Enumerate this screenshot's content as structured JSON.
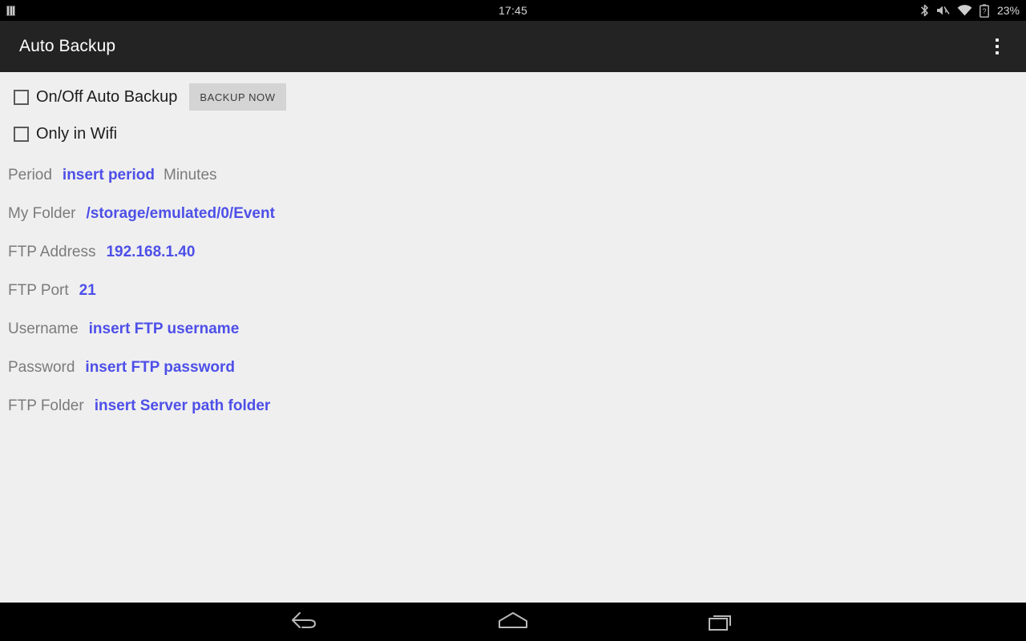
{
  "status_bar": {
    "time": "17:45",
    "battery_percent": "23%",
    "left_icon": "sim-card-icon",
    "icons": [
      "bluetooth-icon",
      "volume-muted-icon",
      "wifi-icon",
      "battery-unknown-icon"
    ]
  },
  "app_bar": {
    "title": "Auto Backup",
    "overflow_label": "overflow-menu"
  },
  "checkboxes": [
    {
      "label": "On/Off Auto Backup",
      "checked": false
    },
    {
      "label": "Only in Wifi",
      "checked": false
    }
  ],
  "buttons": {
    "backup_now": "BACKUP NOW"
  },
  "fields": [
    {
      "label": "Period",
      "value": "insert period",
      "suffix": "Minutes"
    },
    {
      "label": "My Folder",
      "value": "/storage/emulated/0/Event",
      "suffix": ""
    },
    {
      "label": "FTP Address",
      "value": "192.168.1.40",
      "suffix": ""
    },
    {
      "label": "FTP Port",
      "value": "21",
      "suffix": ""
    },
    {
      "label": "Username",
      "value": "insert FTP username",
      "suffix": ""
    },
    {
      "label": "Password",
      "value": "insert FTP password",
      "suffix": ""
    },
    {
      "label": "FTP Folder",
      "value": "insert Server path folder",
      "suffix": ""
    }
  ],
  "nav_bar": {
    "back": "back-button",
    "home": "home-button",
    "recents": "recents-button"
  },
  "colors": {
    "background": "#efefef",
    "app_bar": "#232323",
    "status_bar": "#000000",
    "accent_blue": "#4d4fe8",
    "label_gray": "#7b7b7b",
    "button_gray": "#d4d4d4"
  }
}
